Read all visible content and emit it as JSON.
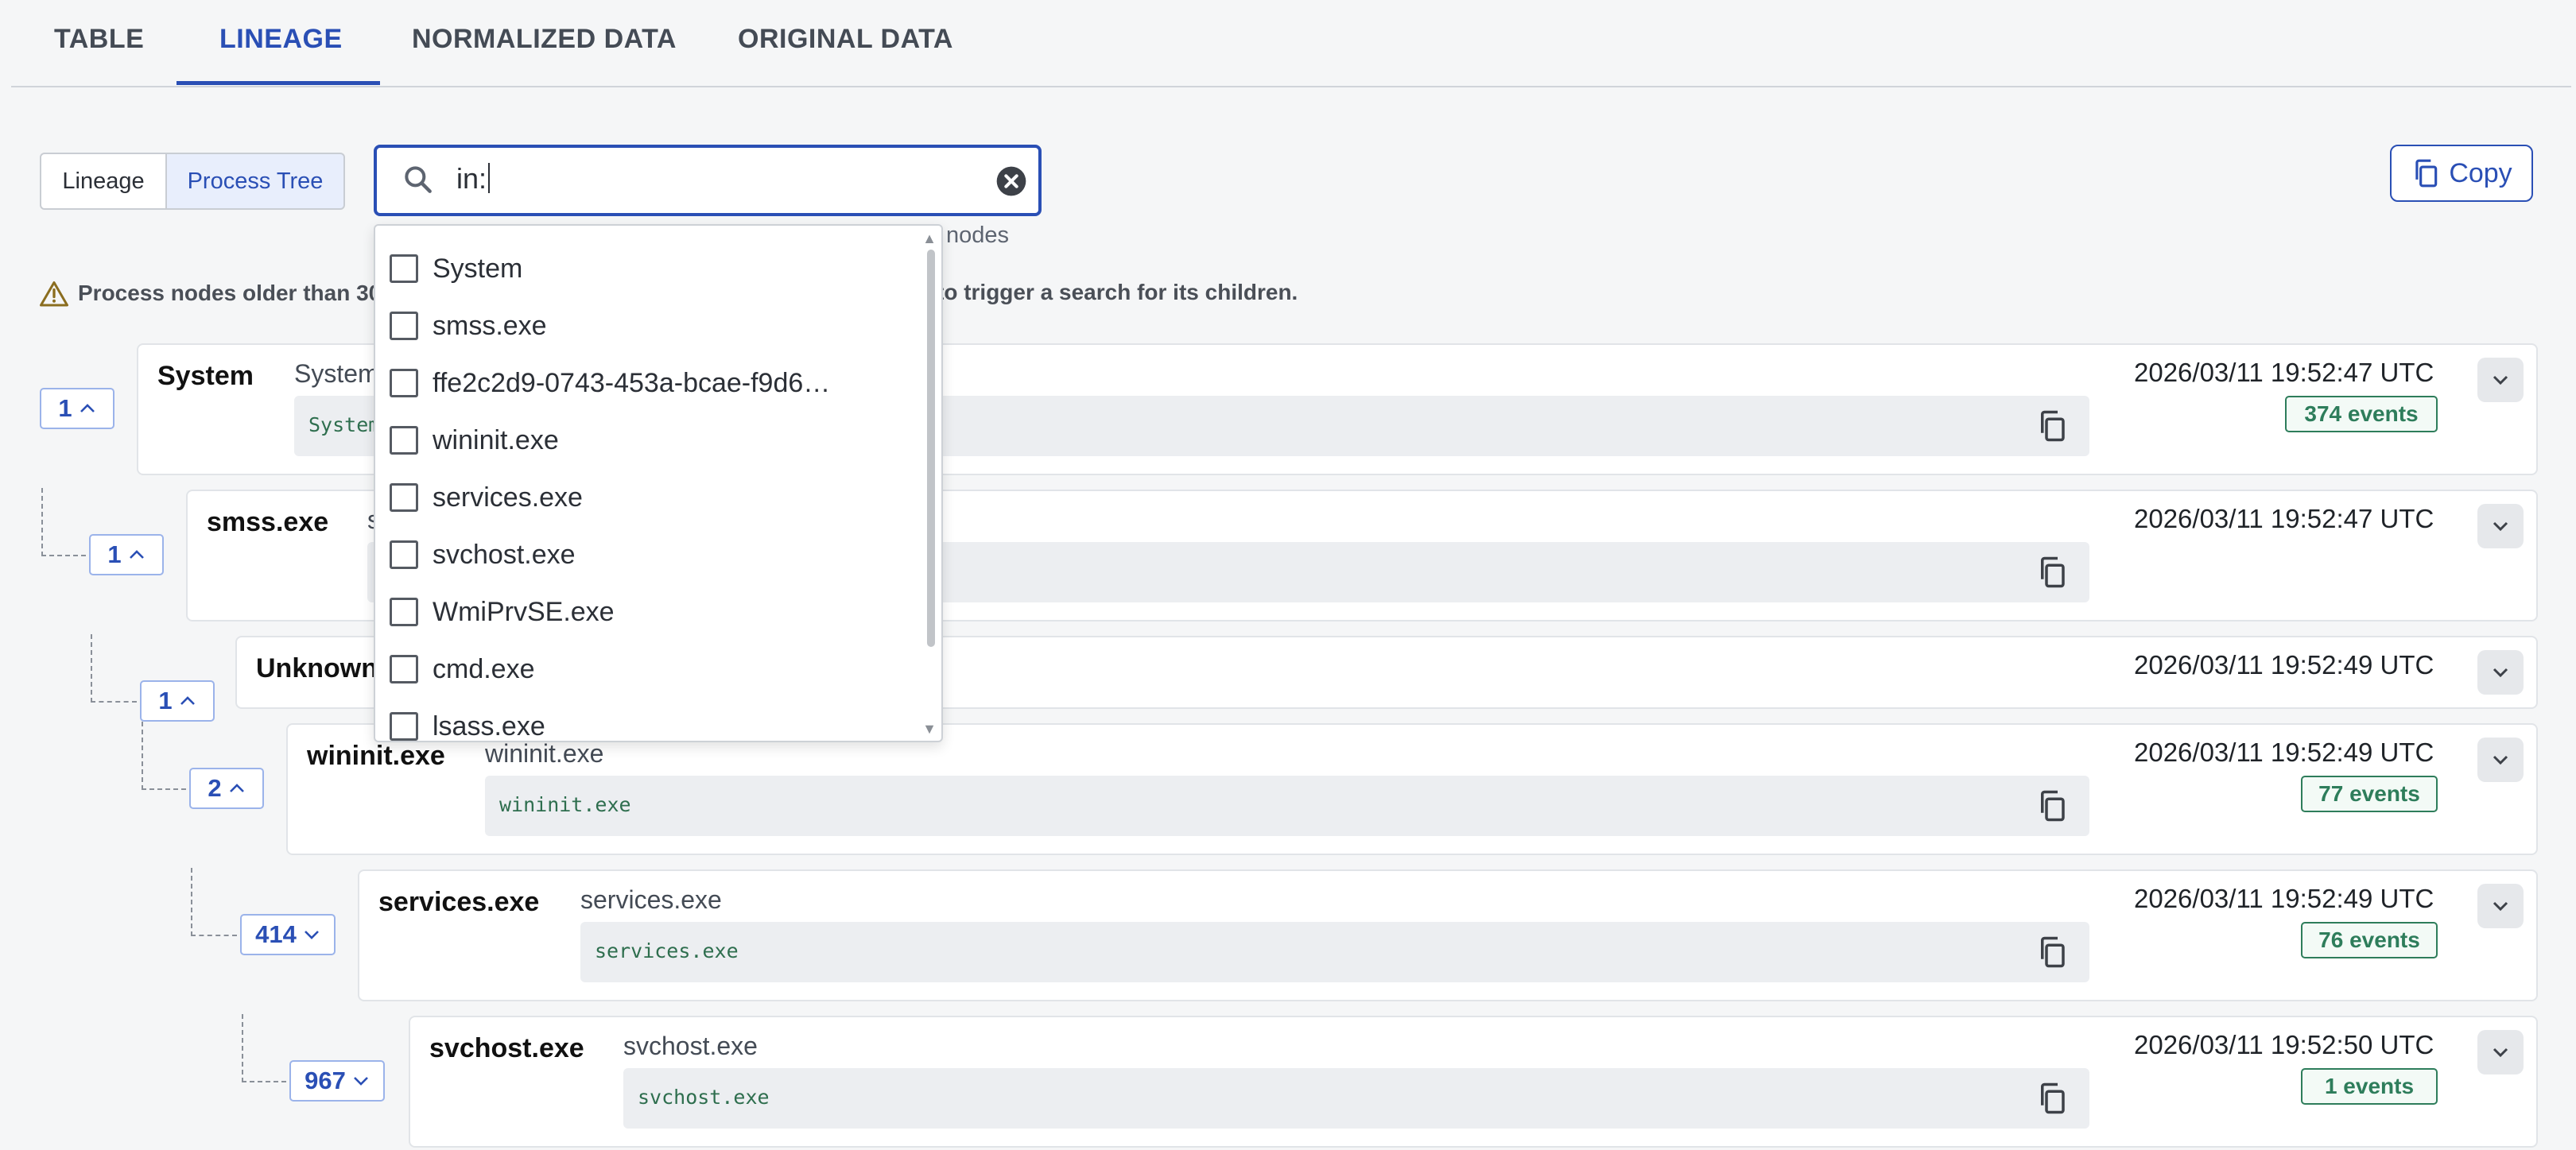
{
  "tabs": [
    "TABLE",
    "LINEAGE",
    "NORMALIZED DATA",
    "ORIGINAL DATA"
  ],
  "active_tab": "LINEAGE",
  "view_toggle": {
    "lineage_label": "Lineage",
    "process_tree_label": "Process Tree",
    "selected": "Process Tree"
  },
  "search": {
    "value": "in:",
    "hint_suffix": "nodes"
  },
  "copy_button": {
    "label": "Copy"
  },
  "warning": {
    "text_start": "Process nodes older than 30",
    "text_end": "to trigger a search for its children."
  },
  "dropdown_options": [
    "System",
    "smss.exe",
    "ffe2c2d9-0743-453a-bcae-f9d6…",
    "wininit.exe",
    "services.exe",
    "svchost.exe",
    "WmiPrvSE.exe",
    "cmd.exe",
    "lsass.exe"
  ],
  "tree": [
    {
      "count": "1",
      "chevron": "up",
      "name": "System",
      "cmd": "System",
      "code": "System",
      "timestamp": "2026/03/11 19:52:47 UTC",
      "events": "374 events"
    },
    {
      "count": "1",
      "chevron": "up",
      "name": "smss.exe",
      "cmd": "s",
      "code": "",
      "timestamp": "2026/03/11 19:52:47 UTC",
      "events": ""
    },
    {
      "count": "1",
      "chevron": "up",
      "name": "Unknown",
      "cmd": "",
      "code": "",
      "timestamp": "2026/03/11 19:52:49 UTC",
      "events": ""
    },
    {
      "count": "2",
      "chevron": "up",
      "name": "wininit.exe",
      "cmd": "wininit.exe",
      "code": "wininit.exe",
      "timestamp": "2026/03/11 19:52:49 UTC",
      "events": "77 events"
    },
    {
      "count": "414",
      "chevron": "down",
      "name": "services.exe",
      "cmd": "services.exe",
      "code": "services.exe",
      "timestamp": "2026/03/11 19:52:49 UTC",
      "events": "76 events"
    },
    {
      "count": "967",
      "chevron": "down",
      "name": "svchost.exe",
      "cmd": "svchost.exe",
      "code": "svchost.exe",
      "timestamp": "2026/03/11 19:52:50 UTC",
      "events": "1 events"
    }
  ],
  "colors": {
    "accent": "#2a4fb5",
    "events_green": "#2e7d5b",
    "code_green": "#2e6e4e"
  }
}
